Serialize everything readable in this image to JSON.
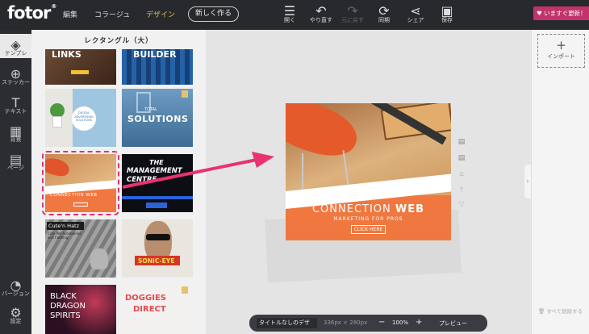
{
  "header": {
    "logo": "fotor",
    "logo_mark": "®",
    "menu": [
      "編集",
      "コラージュ",
      "デザイン"
    ],
    "new_button": "新しく作る",
    "tools": [
      {
        "label": "開く",
        "icon": "hamburger-icon",
        "glyph": "☰"
      },
      {
        "label": "やり直す",
        "icon": "undo-icon",
        "glyph": "↶"
      },
      {
        "label": "元に戻す",
        "icon": "redo-icon",
        "glyph": "↷"
      },
      {
        "label": "同期",
        "icon": "sync-icon",
        "glyph": "⟳"
      },
      {
        "label": "シェア",
        "icon": "share-icon",
        "glyph": "⋖"
      },
      {
        "label": "保存",
        "icon": "save-icon",
        "glyph": "▣"
      }
    ],
    "upgrade": "♥ いますぐ更新！"
  },
  "sidebar": {
    "items": [
      {
        "label": "テンプレ",
        "glyph": "◈"
      },
      {
        "label": "ステッカー",
        "glyph": "⊕"
      },
      {
        "label": "テキスト",
        "glyph": "T"
      },
      {
        "label": "背景",
        "glyph": "▦"
      },
      {
        "label": "ページ",
        "glyph": "▤"
      }
    ],
    "bottom_items": [
      {
        "label": "バージョン",
        "glyph": "◔"
      },
      {
        "label": "設定",
        "glyph": "⚙"
      }
    ]
  },
  "template_panel": {
    "title": "レクタングル（大）",
    "thumbs": [
      {
        "line1": "LINKS",
        "line2": ""
      },
      {
        "line1": "BUILDER",
        "line2": ""
      },
      {
        "line1": "DIGITAL ADVERTISING SOLUTIONS",
        "line2": ""
      },
      {
        "line1": "TOTAL",
        "line2": "SOLUTIONS"
      },
      {
        "line1": "CONNECTION WEB",
        "line2": ""
      },
      {
        "line1": "THE",
        "line2": "MANAGEMENT CENTRE"
      },
      {
        "line1": "Cute'n Hatz",
        "line2": "Cute Pet Accessories and Clothing"
      },
      {
        "line1": "SONIC-EYE",
        "line2": ""
      },
      {
        "line1": "BLACK DRAGON SPIRITS",
        "line2": ""
      },
      {
        "line1": "DOGGIES",
        "line2": "DIRECT"
      }
    ]
  },
  "design": {
    "title_light": "CONNECTION ",
    "title_bold": "WEB",
    "subtitle": "MARKETING FOR PROS",
    "cta": "CLICK HERE"
  },
  "right_panel": {
    "import_label": "インポート",
    "delete_all": "すべて削除する"
  },
  "statusbar": {
    "doc_title": "タイトルなしのデザ",
    "dims": "336px × 280px",
    "zoom": "100%",
    "preview": "プレビュー"
  },
  "colors": {
    "accent": "#e8c341",
    "brand_pink": "#c2336b",
    "design_orange": "#f07840",
    "arrow": "#e8336f"
  }
}
